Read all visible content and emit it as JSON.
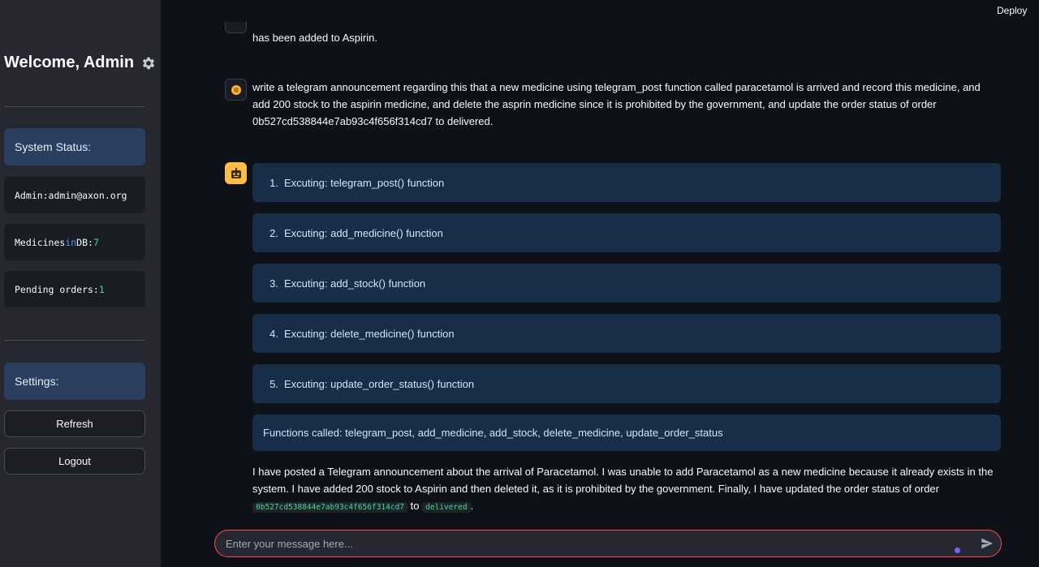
{
  "header": {
    "deploy_label": "Deploy"
  },
  "sidebar": {
    "welcome": "Welcome, Admin",
    "status_title": "System Status:",
    "admin_label": "Admin:",
    "admin_email": "admin@axon.org",
    "medicines_label": "Medicines",
    "medicines_in": "in",
    "medicines_db": "DB:",
    "medicines_count": "7",
    "pending_label": "Pending orders:",
    "pending_count": "1",
    "settings_title": "Settings:",
    "refresh_label": "Refresh",
    "logout_label": "Logout"
  },
  "chat": {
    "prev_tail": "has been added to Aspirin.",
    "user_message": "write a telegram announcement regarding this that a new medicine using telegram_post function called paracetamol is arrived and record this medicine, and add 200 stock to the aspirin medicine, and delete the asprin medicine since it is prohibited by the government, and update the order status of order 0b527cd538844e7ab93c4f656f314cd7 to delivered.",
    "steps": [
      {
        "n": "1.",
        "text": "Excuting: telegram_post() function"
      },
      {
        "n": "2.",
        "text": "Excuting: add_medicine() function"
      },
      {
        "n": "3.",
        "text": "Excuting: add_stock() function"
      },
      {
        "n": "4.",
        "text": "Excuting: delete_medicine() function"
      },
      {
        "n": "5.",
        "text": "Excuting: update_order_status() function"
      }
    ],
    "functions_called": "Functions called: telegram_post, add_medicine, add_stock, delete_medicine, update_order_status",
    "reply_text": "I have posted a Telegram announcement about the arrival of Paracetamol. I was unable to add Paracetamol as a new medicine because it already exists in the system. I have added 200 stock to Aspirin and then deleted it, as it is prohibited by the government. Finally, I have updated the order status of order",
    "reply_order_id": "0b527cd538844e7ab93c4f656f314cd7",
    "reply_to": "to",
    "reply_status": "delivered",
    "reply_end": "."
  },
  "input": {
    "placeholder": "Enter your message here..."
  },
  "colors": {
    "accent": "#ff4b4b",
    "bot_avatar": "#ffbd45",
    "step_bg": "#172d48",
    "sidebar_bg": "#262730"
  },
  "icons": {
    "settings": "gear-icon",
    "user_avatar": "user-avatar-icon",
    "bot_avatar": "robot-icon",
    "send": "send-icon"
  }
}
